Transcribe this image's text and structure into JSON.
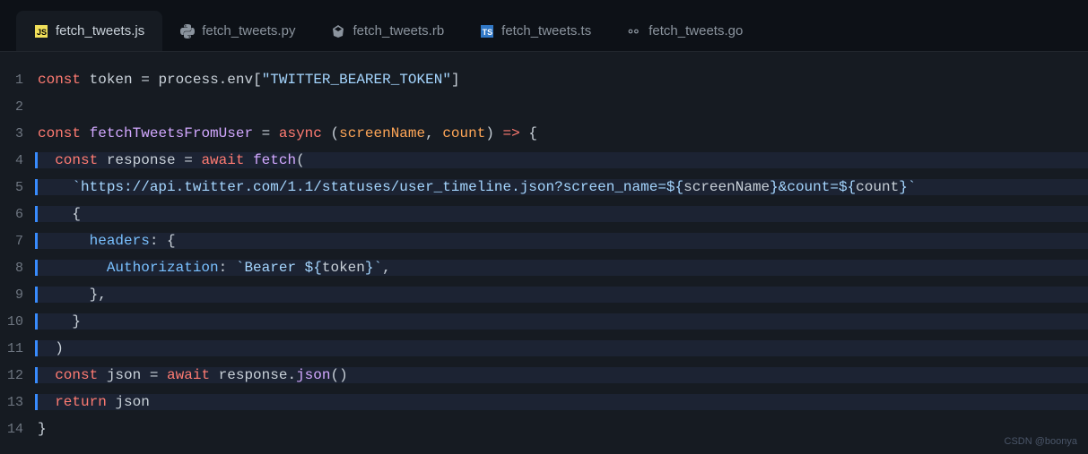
{
  "tabs": [
    {
      "label": "fetch_tweets.js",
      "icon": "js",
      "active": true
    },
    {
      "label": "fetch_tweets.py",
      "icon": "python",
      "active": false
    },
    {
      "label": "fetch_tweets.rb",
      "icon": "ruby",
      "active": false
    },
    {
      "label": "fetch_tweets.ts",
      "icon": "ts",
      "active": false
    },
    {
      "label": "fetch_tweets.go",
      "icon": "go",
      "active": false
    }
  ],
  "code": {
    "line1": {
      "const": "const",
      "token": "token",
      "eq": " = ",
      "process": "process",
      "dot": ".",
      "env": "env",
      "br1": "[",
      "str": "\"TWITTER_BEARER_TOKEN\"",
      "br2": "]"
    },
    "line3": {
      "const": "const",
      "fn": "fetchTweetsFromUser",
      "eq": " = ",
      "async": "async",
      "paren1": " (",
      "p1": "screenName",
      "comma": ", ",
      "p2": "count",
      "paren2": ") ",
      "arrow": "=>",
      "brace": " {"
    },
    "line4": {
      "indent": "  ",
      "const": "const",
      "var": " response ",
      "eq": "= ",
      "await": "await",
      "sp": " ",
      "fetch": "fetch",
      "paren": "("
    },
    "line5": {
      "indent": "    ",
      "tick": "`",
      "url1": "https://api.twitter.com/1.1/statuses/user_timeline.json?screen_name=",
      "int1": "${",
      "v1": "screenName",
      "int1e": "}",
      "url2": "&count=",
      "int2": "${",
      "v2": "count",
      "int2e": "}",
      "tick2": "`"
    },
    "line6": {
      "indent": "    ",
      "brace": "{"
    },
    "line7": {
      "indent": "      ",
      "prop": "headers",
      "colon": ": {"
    },
    "line8": {
      "indent": "        ",
      "prop": "Authorization",
      "colon": ": ",
      "tick": "`",
      "str": "Bearer ",
      "int1": "${",
      "v1": "token",
      "int1e": "}",
      "tick2": "`",
      "comma": ","
    },
    "line9": {
      "indent": "      ",
      "brace": "},"
    },
    "line10": {
      "indent": "    ",
      "brace": "}"
    },
    "line11": {
      "indent": "  ",
      "paren": ")"
    },
    "line12": {
      "indent": "  ",
      "const": "const",
      "var": " json ",
      "eq": "= ",
      "await": "await",
      "sp": " response.",
      "fn": "json",
      "paren": "()"
    },
    "line13": {
      "indent": "  ",
      "return": "return",
      "var": " json"
    },
    "line14": {
      "brace": "}"
    }
  },
  "lineNumbers": [
    "1",
    "2",
    "3",
    "4",
    "5",
    "6",
    "7",
    "8",
    "9",
    "10",
    "11",
    "12",
    "13",
    "14"
  ],
  "watermark": "CSDN @boonya"
}
